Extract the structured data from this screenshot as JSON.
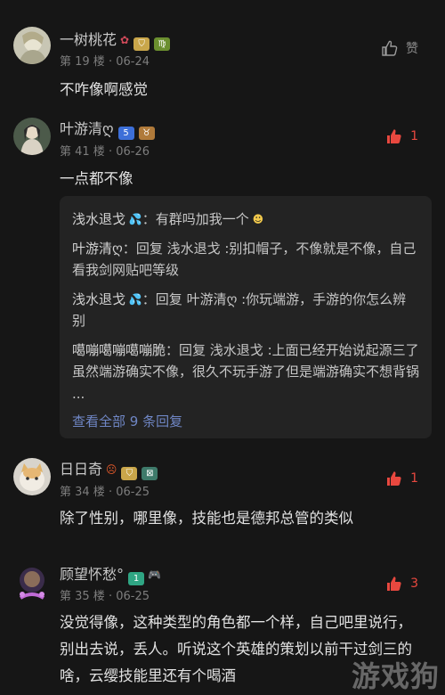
{
  "comments": [
    {
      "username": "一树桃花",
      "floor": "第 19 楼",
      "date": "06-24",
      "text": "不咋像啊感觉",
      "like_label": "赞",
      "like_count": ""
    },
    {
      "username": "叶游清ღ",
      "floor": "第 41 楼",
      "date": "06-26",
      "text": "一点都不像",
      "like_count": "1",
      "replies": [
        {
          "name": "浅水退戈",
          "text": "有群吗加我一个"
        },
        {
          "name": "叶游清ღ",
          "text": "回复 浅水退戈 :别扣帽子，不像就是不像，自己看我剑网贴吧等级"
        },
        {
          "name": "浅水退戈",
          "text": "回复 叶游清ღ :你玩端游，手游的你怎么辨别"
        },
        {
          "name": "噶嘣噶嘣噶嘣脆",
          "text": "回复 浅水退戈 :上面已经开始说起源三了虽然端游确实不像，很久不玩手游了但是端游确实不想背锅 ..."
        }
      ],
      "view_all": "查看全部 9 条回复"
    },
    {
      "username": "日日奇",
      "floor": "第 34 楼",
      "date": "06-25",
      "text": "除了性别，哪里像，技能也是德邦总管的类似",
      "like_count": "1"
    },
    {
      "username": "顾望怀愁°",
      "floor": "第 35 楼",
      "date": "06-25",
      "text": "没觉得像，这种类型的角色都一个样，自己吧里说行，别出去说，丢人。听说这个英雄的策划以前干过剑三的啥，云缨技能里还有个喝酒",
      "like_count": "3"
    }
  ],
  "dot": "·",
  "watermark": "游戏狗",
  "colors": {
    "like_red": "#e8483f",
    "link_blue": "#6f86c4"
  }
}
